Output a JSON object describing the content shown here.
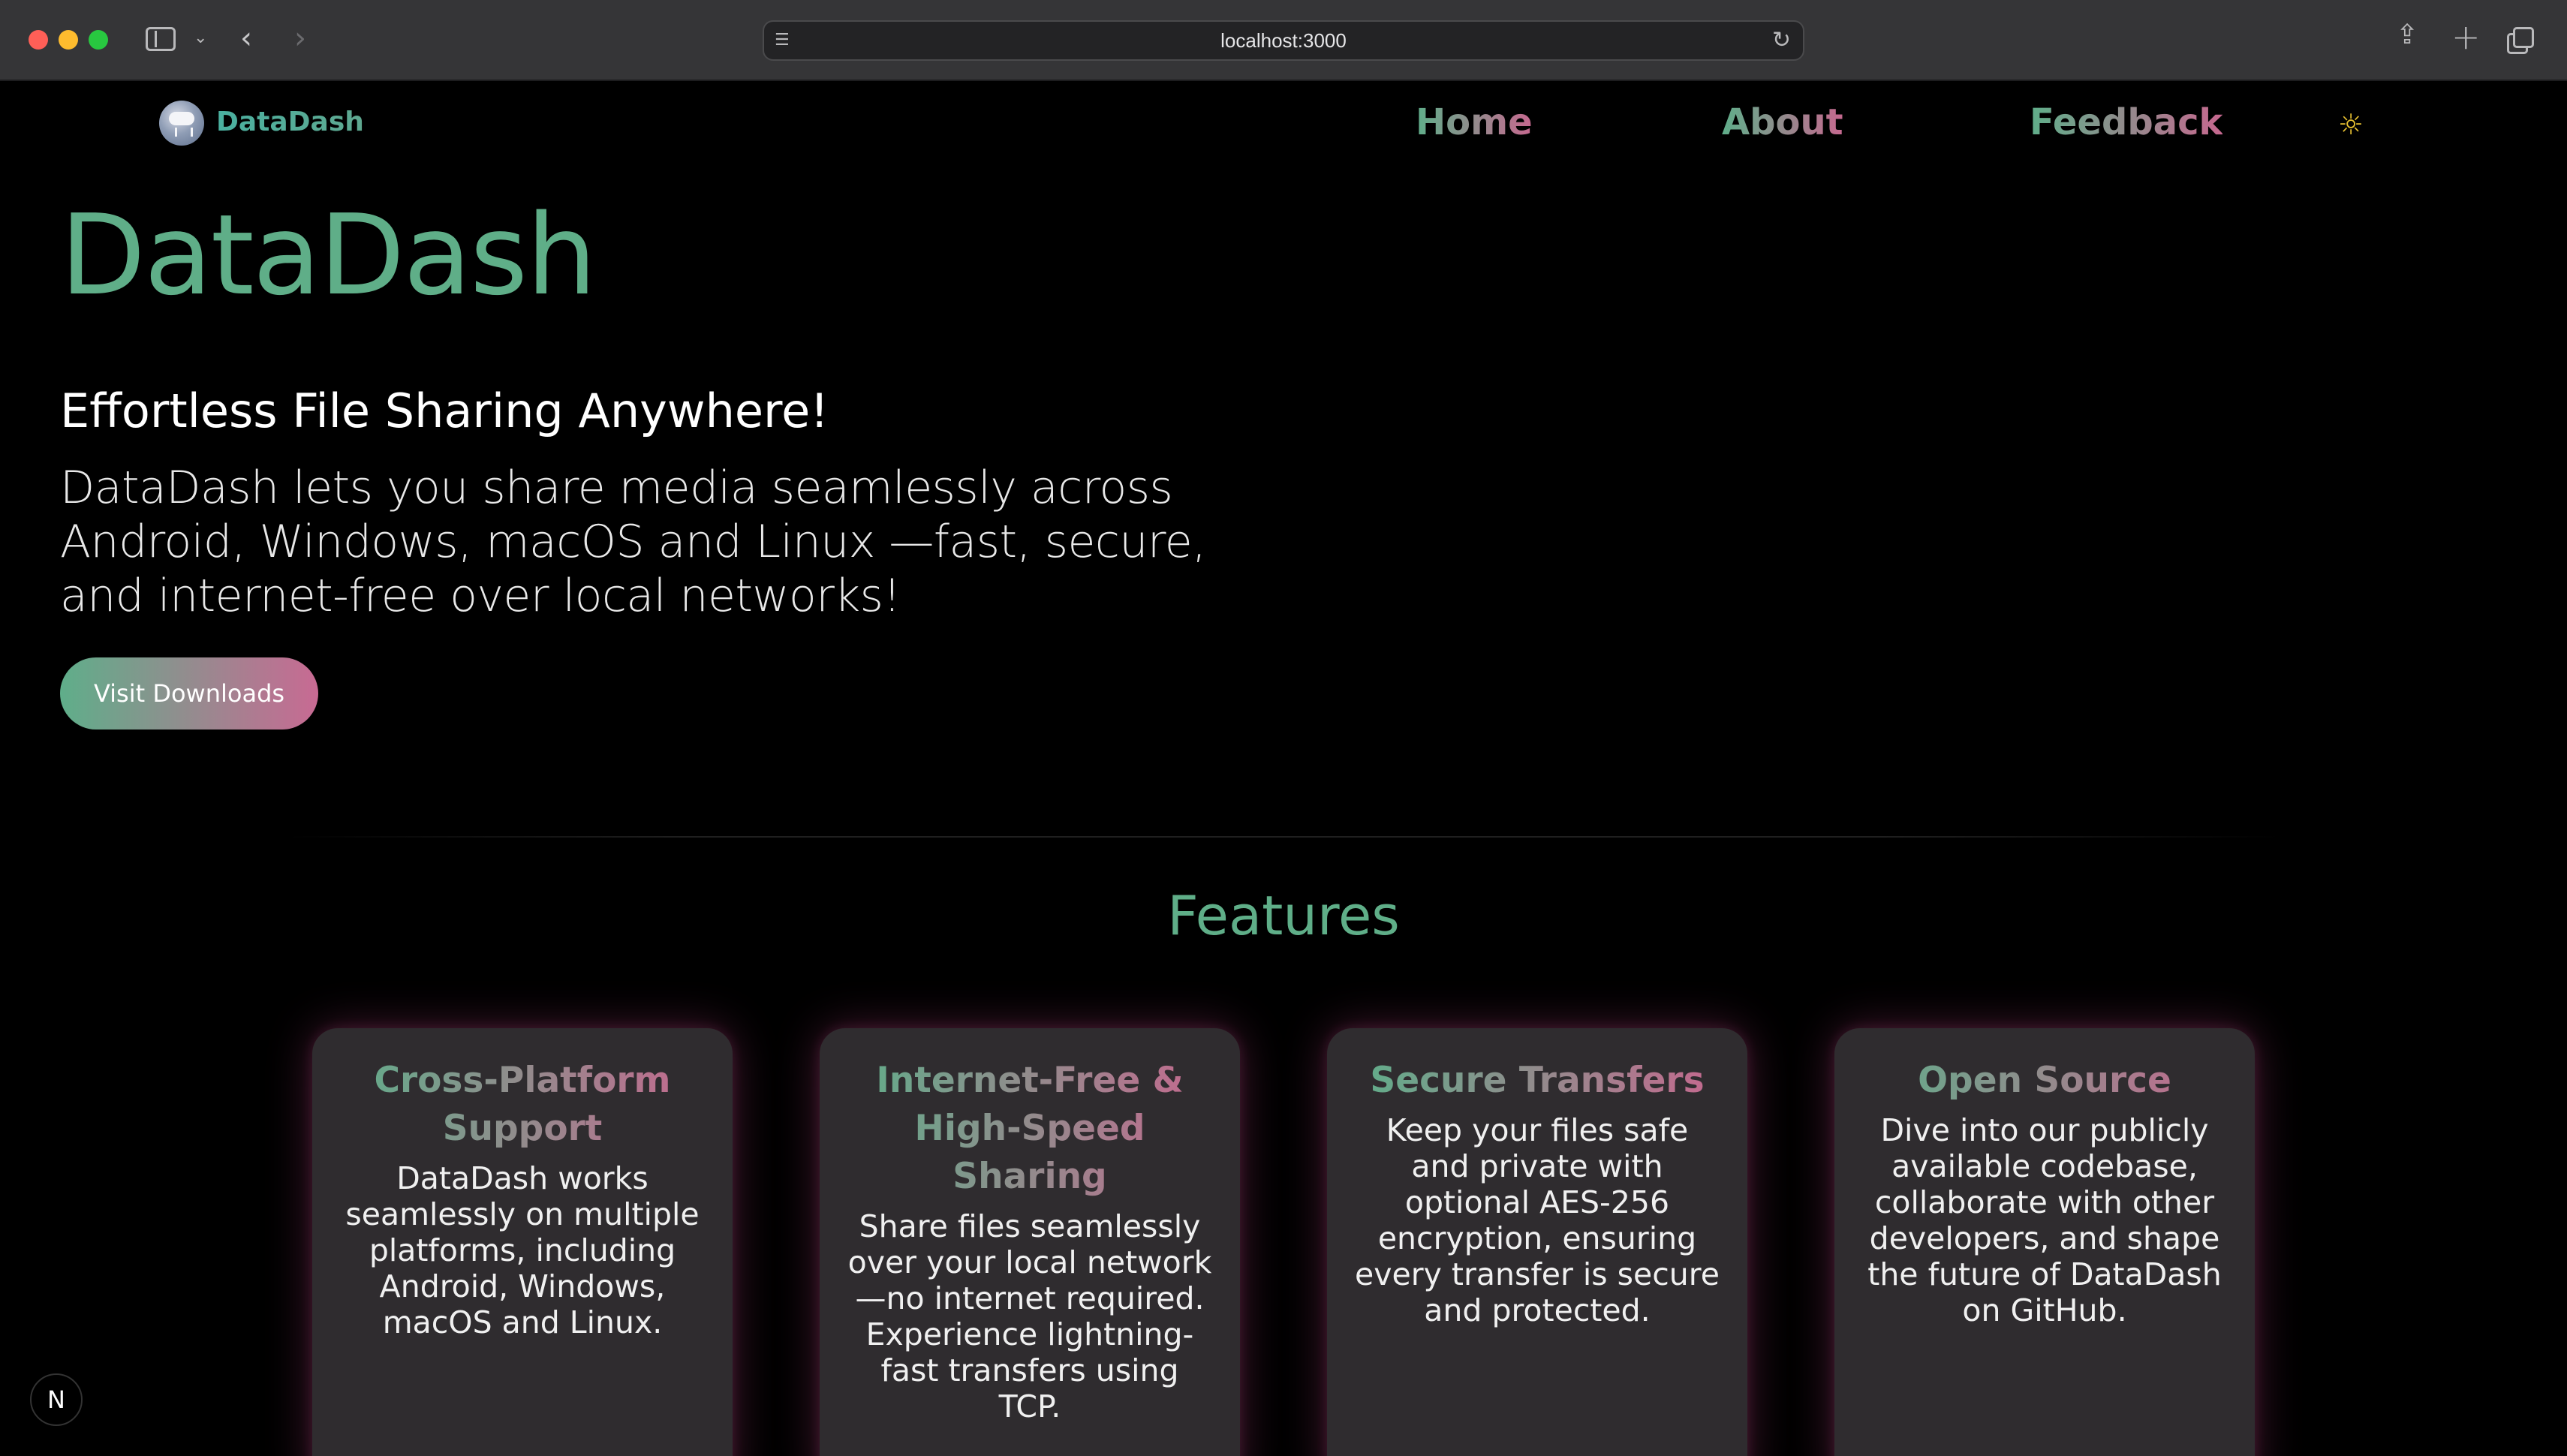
{
  "browser": {
    "url": "localhost:3000",
    "icons": {
      "sidebar": "sidebar-icon",
      "back": "chevron-left-icon",
      "forward": "chevron-right-icon",
      "page": "page-settings-icon",
      "reload": "reload-icon",
      "share": "share-icon",
      "new_tab": "plus-icon",
      "tab_overview": "tabs-icon"
    }
  },
  "navbar": {
    "brand": "DataDash",
    "links": [
      "Home",
      "About",
      "Feedback"
    ],
    "theme_icon": "sun-icon"
  },
  "hero": {
    "title": "DataDash",
    "subtitle": "Effortless File Sharing Anywhere!",
    "description": "DataDash lets you share media seamlessly across Android, Windows, macOS and Linux —fast, secure, and internet-free over local networks!",
    "cta_label": "Visit Downloads"
  },
  "features": {
    "title": "Features",
    "cards": [
      {
        "title": "Cross-Platform Support",
        "text": "DataDash works seamlessly on multiple platforms, including Android, Windows, macOS and Linux."
      },
      {
        "title": "Internet-Free & High-Speed Sharing",
        "text": "Share files seamlessly over your local network —no internet required. Experience lightning-fast transfers using TCP."
      },
      {
        "title": "Secure Transfers",
        "text": "Keep your files safe and private with optional AES-256 encryption, ensuring every transfer is secure and protected."
      },
      {
        "title": "Open Source",
        "text": "Dive into our publicly available codebase, collaborate with other developers, and shape the future of DataDash on GitHub."
      }
    ]
  },
  "dev_badge": "N",
  "colors": {
    "accent_green": "#5fae88",
    "accent_pink": "#c6688f",
    "card_bg": "#2f2c2f",
    "theme_icon": "#e9c231"
  }
}
